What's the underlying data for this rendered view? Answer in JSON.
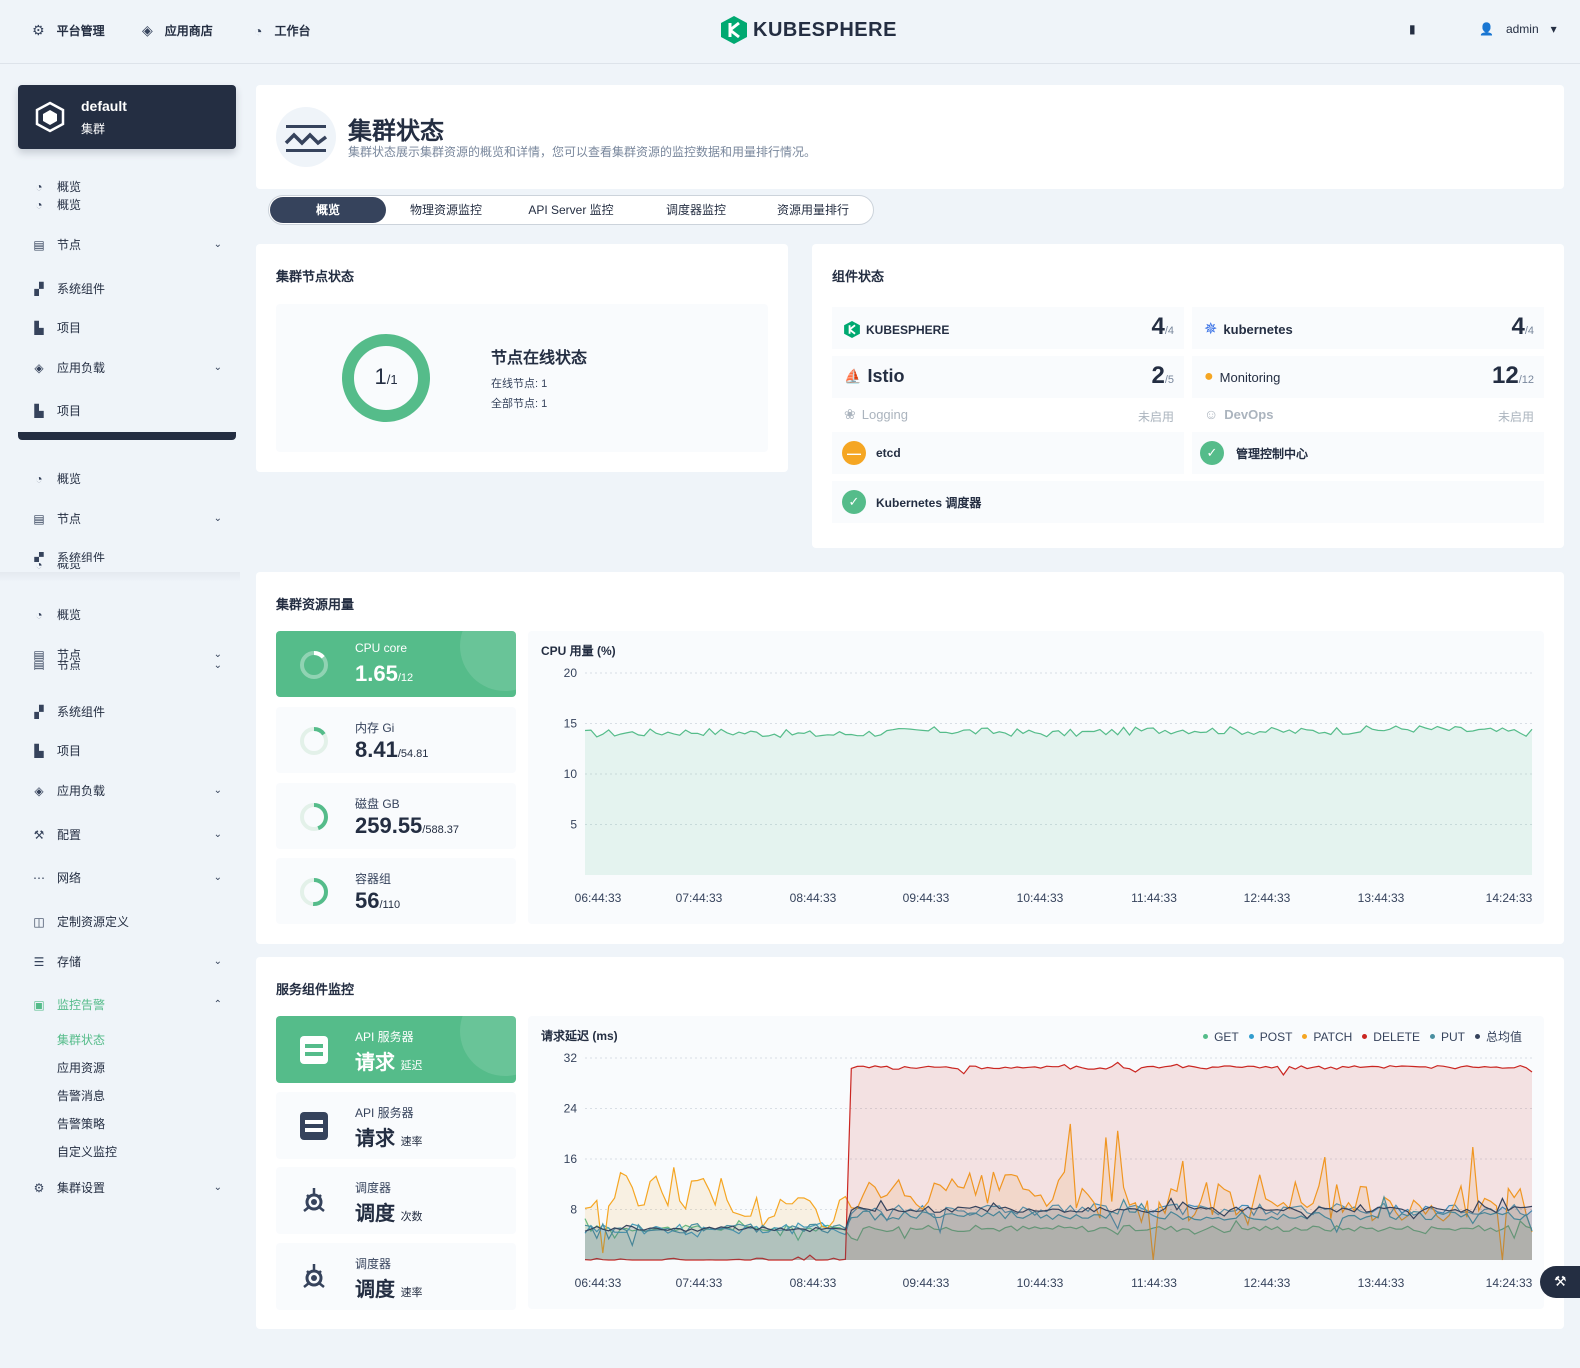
{
  "topnav": {
    "items": [
      {
        "label": "平台管理",
        "icon": "gear-icon"
      },
      {
        "label": "应用商店",
        "icon": "layers-icon"
      },
      {
        "label": "工作台",
        "icon": "dashboard-icon"
      }
    ],
    "logo": "KUBESPHERE",
    "user": "admin"
  },
  "cluster": {
    "name": "default",
    "type": "集群"
  },
  "sidebar": {
    "ghost1": [
      "概览",
      "概览",
      "节点",
      "系统组件",
      "项目",
      "应用负载",
      "项目"
    ],
    "ghost2": [
      "概览",
      "节点",
      "系统组件",
      "概览"
    ],
    "menu": [
      "概览",
      "节点",
      "节点",
      "系统组件",
      "项目",
      "应用负载",
      "配置",
      "网络",
      "定制资源定义",
      "存储",
      "监控告警"
    ],
    "sub": [
      "集群状态",
      "应用资源",
      "告警消息",
      "告警策略",
      "自定义监控"
    ],
    "settings": "集群设置"
  },
  "header": {
    "title": "集群状态",
    "desc": "集群状态展示集群资源的概览和详情，您可以查看集群资源的监控数据和用量排行情况。"
  },
  "tabs": [
    "概览",
    "物理资源监控",
    "API Server 监控",
    "调度器监控",
    "资源用量排行"
  ],
  "node_status": {
    "title": "集群节点状态",
    "online": "1",
    "total": "/1",
    "heading": "节点在线状态",
    "online_label": "在线节点: 1",
    "total_label": "全部节点: 1"
  },
  "components": {
    "title": "组件状态",
    "kubesphere": {
      "name": "KUBESPHERE",
      "count": "4",
      "total": "/4"
    },
    "kubernetes": {
      "name": "kubernetes",
      "count": "4",
      "total": "/4"
    },
    "istio": {
      "name": "Istio",
      "count": "2",
      "total": "/5"
    },
    "monitoring": {
      "name": "Monitoring",
      "count": "12",
      "total": "/12"
    },
    "logging": {
      "name": "Logging",
      "status": "未启用"
    },
    "devops": {
      "name": "DevOps",
      "status": "未启用"
    },
    "etcd": {
      "name": "etcd"
    },
    "controller": {
      "name": "管理控制中心"
    },
    "scheduler": {
      "name": "Kubernetes 调度器"
    }
  },
  "resources": {
    "title": "集群资源用量",
    "cards": [
      {
        "label": "CPU core",
        "value": "1.65",
        "total": "/12",
        "usage": 0.1375
      },
      {
        "label": "内存 Gi",
        "value": "8.41",
        "total": "/54.81",
        "usage": 0.153
      },
      {
        "label": "磁盘 GB",
        "value": "259.55",
        "total": "/588.37",
        "usage": 0.441
      },
      {
        "label": "容器组",
        "value": "56",
        "total": "/110",
        "usage": 0.509
      }
    ],
    "chart_title": "CPU 用量 (%)"
  },
  "service": {
    "title": "服务组件监控",
    "cards": [
      {
        "label": "API 服务器",
        "value": "请求",
        "unit": "延迟"
      },
      {
        "label": "API 服务器",
        "value": "请求",
        "unit": "速率"
      },
      {
        "label": "调度器",
        "value": "调度",
        "unit": "次数"
      },
      {
        "label": "调度器",
        "value": "调度",
        "unit": "速率"
      }
    ],
    "chart_title": "请求延迟 (ms)"
  },
  "chart_data": [
    {
      "type": "area",
      "title": "CPU 用量 (%)",
      "x": [
        "06:44:33",
        "07:44:33",
        "08:44:33",
        "09:44:33",
        "10:44:33",
        "11:44:33",
        "12:44:33",
        "13:44:33",
        "14:24:33"
      ],
      "yticks": [
        "20",
        "15",
        "10",
        "5"
      ],
      "ylim": [
        0,
        20
      ],
      "grid": true,
      "series": [
        {
          "values": [
            14,
            14.2,
            13.9,
            14.3,
            14,
            14.4,
            14.2,
            14.5,
            14.1
          ],
          "color": "#55bc8a"
        }
      ]
    },
    {
      "type": "area",
      "title": "请求延迟 (ms)",
      "x": [
        "06:44:33",
        "07:44:33",
        "08:44:33",
        "09:44:33",
        "10:44:33",
        "11:44:33",
        "12:44:33",
        "13:44:33",
        "14:24:33"
      ],
      "yticks": [
        "32",
        "24",
        "16",
        "8"
      ],
      "ylim": [
        0,
        32
      ],
      "grid": true,
      "legend_position": "top-right",
      "series": [
        {
          "name": "GET",
          "color": "#55bc8a",
          "values": [
            5,
            5,
            5,
            5,
            5,
            5,
            5,
            5,
            5
          ]
        },
        {
          "name": "POST",
          "color": "#329dce",
          "values": [
            5,
            5,
            5,
            8,
            8,
            8,
            8,
            8,
            8
          ]
        },
        {
          "name": "PATCH",
          "color": "#f5a623",
          "values": [
            9,
            11,
            8,
            10,
            11,
            9,
            10,
            9,
            9
          ]
        },
        {
          "name": "DELETE",
          "color": "#ca2621",
          "values": [
            0,
            0,
            0,
            30.5,
            30.5,
            30.5,
            30.5,
            30.5,
            30.5
          ]
        },
        {
          "name": "PUT",
          "color": "#4a8fa0",
          "values": [
            5,
            5,
            5,
            7,
            7,
            7,
            7,
            7,
            7
          ]
        },
        {
          "name": "总均值",
          "color": "#36435c",
          "values": [
            5,
            5,
            5,
            8,
            8,
            8,
            8,
            8,
            8
          ]
        }
      ]
    }
  ]
}
